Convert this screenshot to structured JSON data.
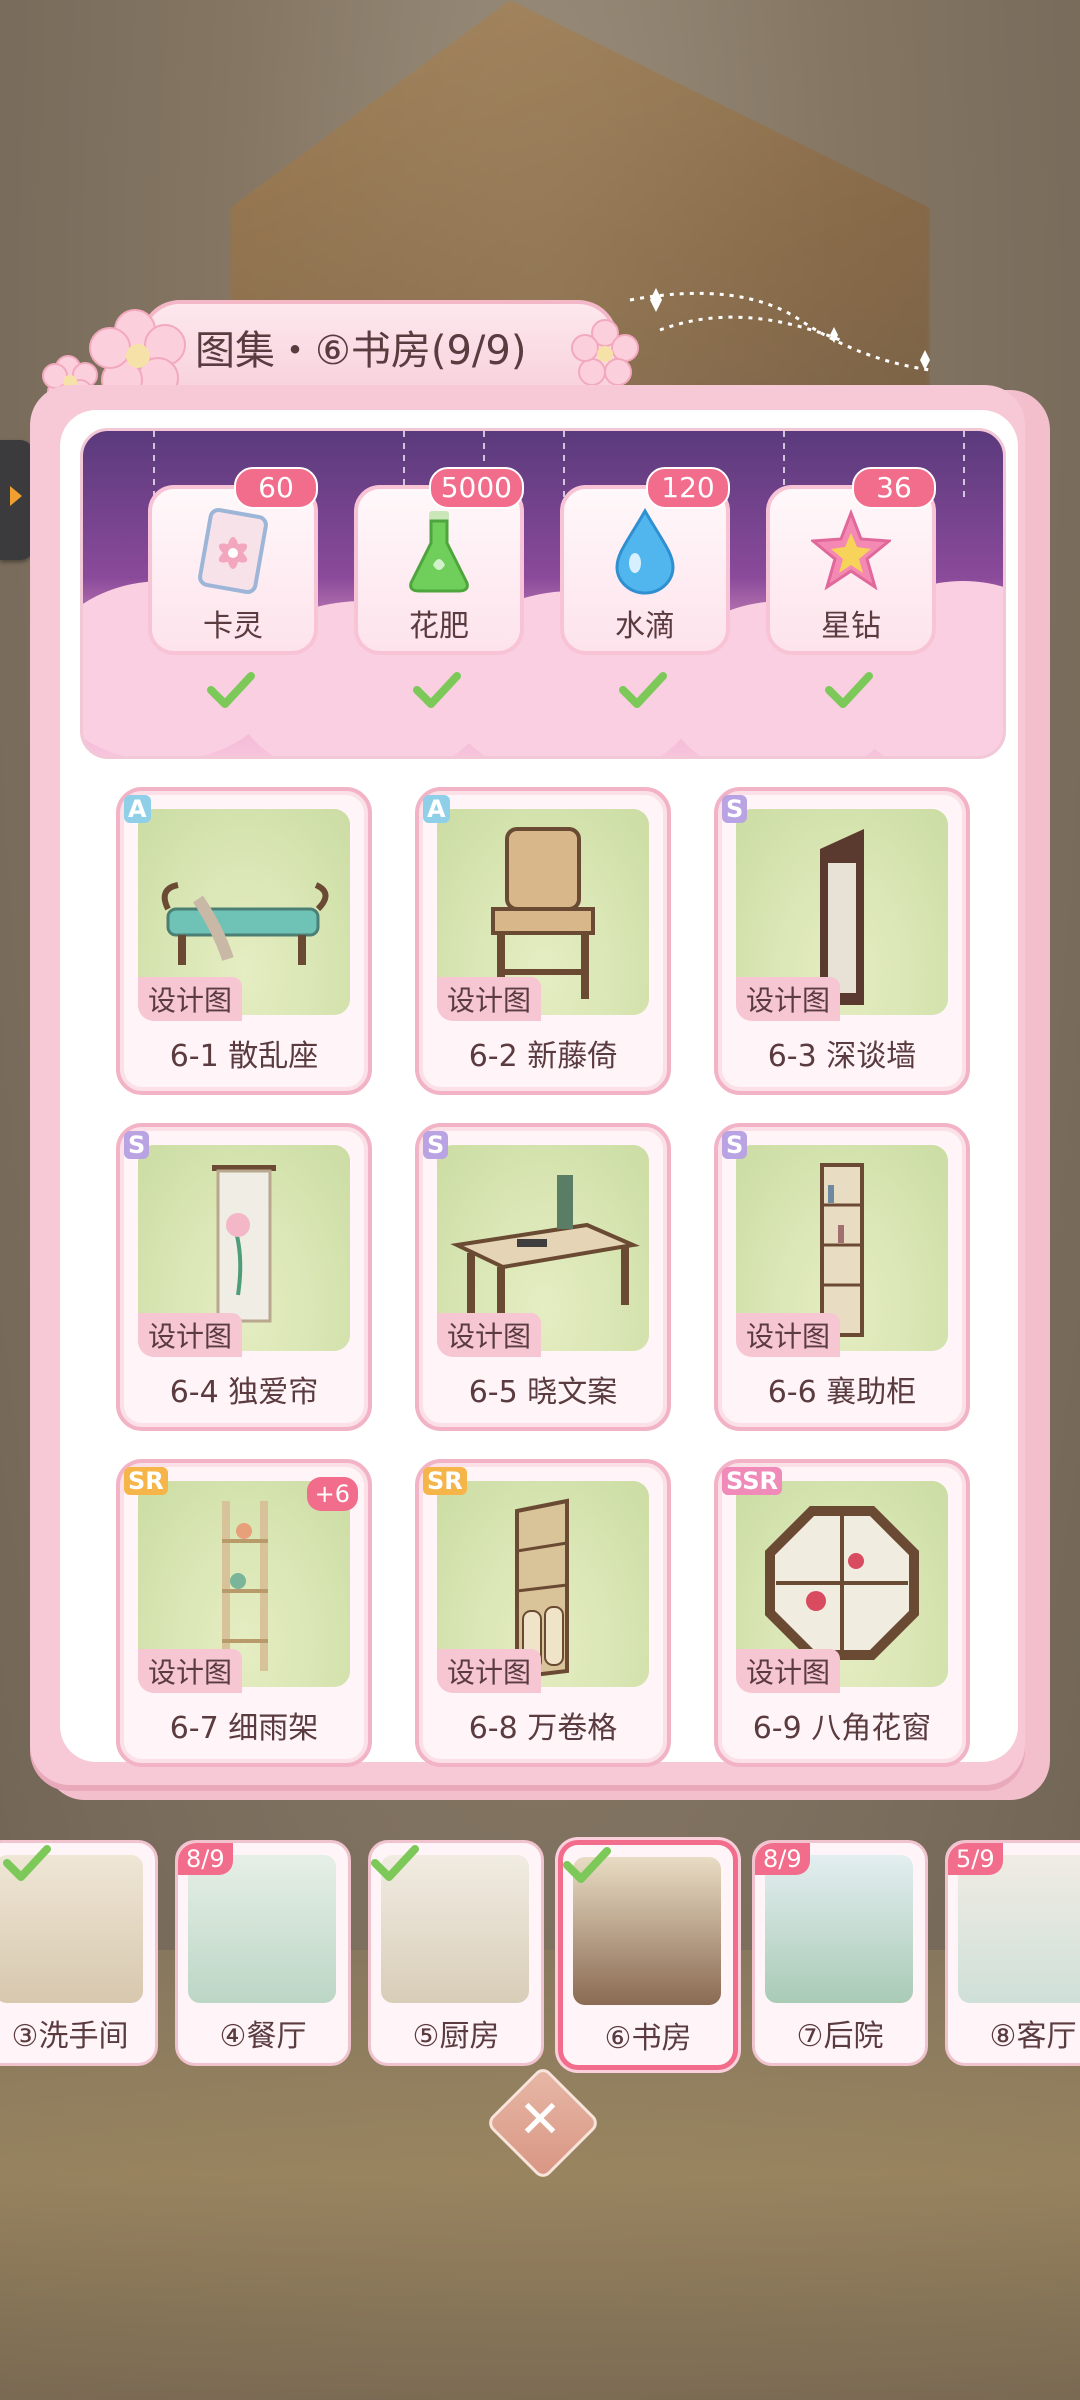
{
  "title": "图集・⑥书房(9/9)",
  "rewards": [
    {
      "name": "卡灵",
      "count": "60",
      "icon": "card-spirit-icon",
      "claimed": true
    },
    {
      "name": "花肥",
      "count": "5000",
      "icon": "fertilizer-flask-icon",
      "claimed": true
    },
    {
      "name": "水滴",
      "count": "120",
      "icon": "water-drop-icon",
      "claimed": true
    },
    {
      "name": "星钻",
      "count": "36",
      "icon": "star-diamond-icon",
      "claimed": true
    }
  ],
  "items": [
    {
      "id": "6-1",
      "name": "6-1 散乱座",
      "rarity": "A",
      "tag": "设计图",
      "extra": ""
    },
    {
      "id": "6-2",
      "name": "6-2 新藤倚",
      "rarity": "A",
      "tag": "设计图",
      "extra": ""
    },
    {
      "id": "6-3",
      "name": "6-3 深谈墙",
      "rarity": "S",
      "tag": "设计图",
      "extra": ""
    },
    {
      "id": "6-4",
      "name": "6-4 独爱帘",
      "rarity": "S",
      "tag": "设计图",
      "extra": ""
    },
    {
      "id": "6-5",
      "name": "6-5 晓文案",
      "rarity": "S",
      "tag": "设计图",
      "extra": ""
    },
    {
      "id": "6-6",
      "name": "6-6 襄助柜",
      "rarity": "S",
      "tag": "设计图",
      "extra": ""
    },
    {
      "id": "6-7",
      "name": "6-7 细雨架",
      "rarity": "SR",
      "tag": "设计图",
      "extra": "+6"
    },
    {
      "id": "6-8",
      "name": "6-8 万卷格",
      "rarity": "SR",
      "tag": "设计图",
      "extra": ""
    },
    {
      "id": "6-9",
      "name": "6-9 八角花窗",
      "rarity": "SSR",
      "tag": "设计图",
      "extra": ""
    }
  ],
  "rooms": [
    {
      "label": "③洗手间",
      "progress": "",
      "complete": true,
      "active": false
    },
    {
      "label": "④餐厅",
      "progress": "8/9",
      "complete": false,
      "active": false
    },
    {
      "label": "⑤厨房",
      "progress": "",
      "complete": true,
      "active": false
    },
    {
      "label": "⑥书房",
      "progress": "",
      "complete": true,
      "active": true
    },
    {
      "label": "⑦后院",
      "progress": "8/9",
      "complete": false,
      "active": false
    },
    {
      "label": "⑧客厅",
      "progress": "5/9",
      "complete": false,
      "active": false
    }
  ],
  "colors": {
    "accent_pink": "#f26d8b",
    "rarity_A": "#8fd0e8",
    "rarity_S": "#b9a3e3",
    "rarity_SR": "#f6b548",
    "rarity_SSR": "#f08ab8",
    "check_green": "#7cc95a"
  }
}
